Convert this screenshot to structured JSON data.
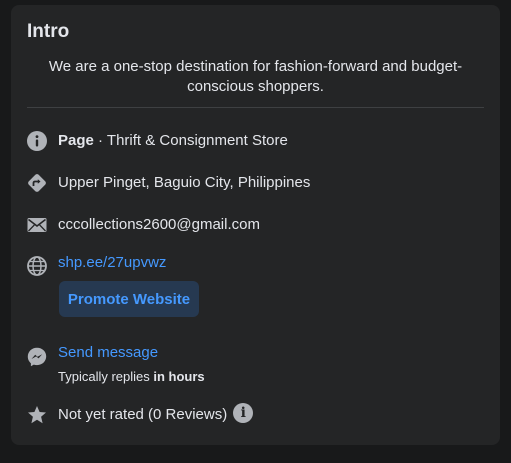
{
  "intro": {
    "title": "Intro",
    "bio": "We are a one-stop destination for fashion-forward and budget-conscious shoppers."
  },
  "page_category": {
    "label": "Page",
    "separator": " · ",
    "value": "Thrift & Consignment Store",
    "icon": "info-icon"
  },
  "address": {
    "text": "Upper Pinget, Baguio City, Philippines",
    "icon": "directions-icon"
  },
  "email": {
    "text": "cccollections2600@gmail.com",
    "icon": "mail-icon"
  },
  "website": {
    "text": "shp.ee/27upvwz",
    "icon": "globe-icon",
    "promote_label": "Promote Website"
  },
  "messenger": {
    "link_text": "Send message",
    "reply_prefix": "Typically replies ",
    "reply_time": "in hours",
    "icon": "messenger-icon"
  },
  "rating": {
    "text": "Not yet rated (0 Reviews)",
    "icon": "star-icon",
    "info_glyph": "i"
  },
  "colors": {
    "card_bg": "#242526",
    "page_bg": "#18191a",
    "link": "#4599ff",
    "button_bg": "#263951",
    "icon_gray": "#b0b3b8"
  }
}
